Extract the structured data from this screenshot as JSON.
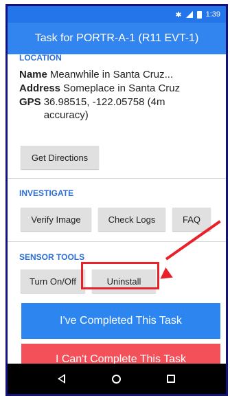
{
  "status_bar": {
    "time": "1:39",
    "icons": [
      "bluetooth-icon",
      "signal-icon",
      "battery-icon"
    ]
  },
  "header": {
    "title": "Task for PORTR-A-1 (R11 EVT-1)"
  },
  "location": {
    "section_title": "LOCATION",
    "name_label": "Name",
    "name_value": "Meanwhile in Santa Cruz...",
    "address_label": "Address",
    "address_value": "Someplace in Santa Cruz",
    "gps_label": "GPS",
    "gps_value": "36.98515, -122.05758 (4m accuracy)",
    "directions_button": "Get Directions"
  },
  "investigate": {
    "section_title": "INVESTIGATE",
    "buttons": [
      "Verify Image",
      "Check Logs",
      "FAQ"
    ]
  },
  "sensor_tools": {
    "section_title": "SENSOR TOOLS",
    "buttons": [
      "Turn On/Off",
      "Uninstall"
    ]
  },
  "actions": {
    "complete_button": "I've Completed This Task",
    "cannot_complete_button": "I Can't Complete This Task"
  },
  "colors": {
    "primary": "#3285ee",
    "section_title": "#2c6fd6",
    "complete": "#2d86f0",
    "cannot_complete": "#f4505a",
    "annotation": "#e8202a",
    "frame_border": "#12127a"
  }
}
